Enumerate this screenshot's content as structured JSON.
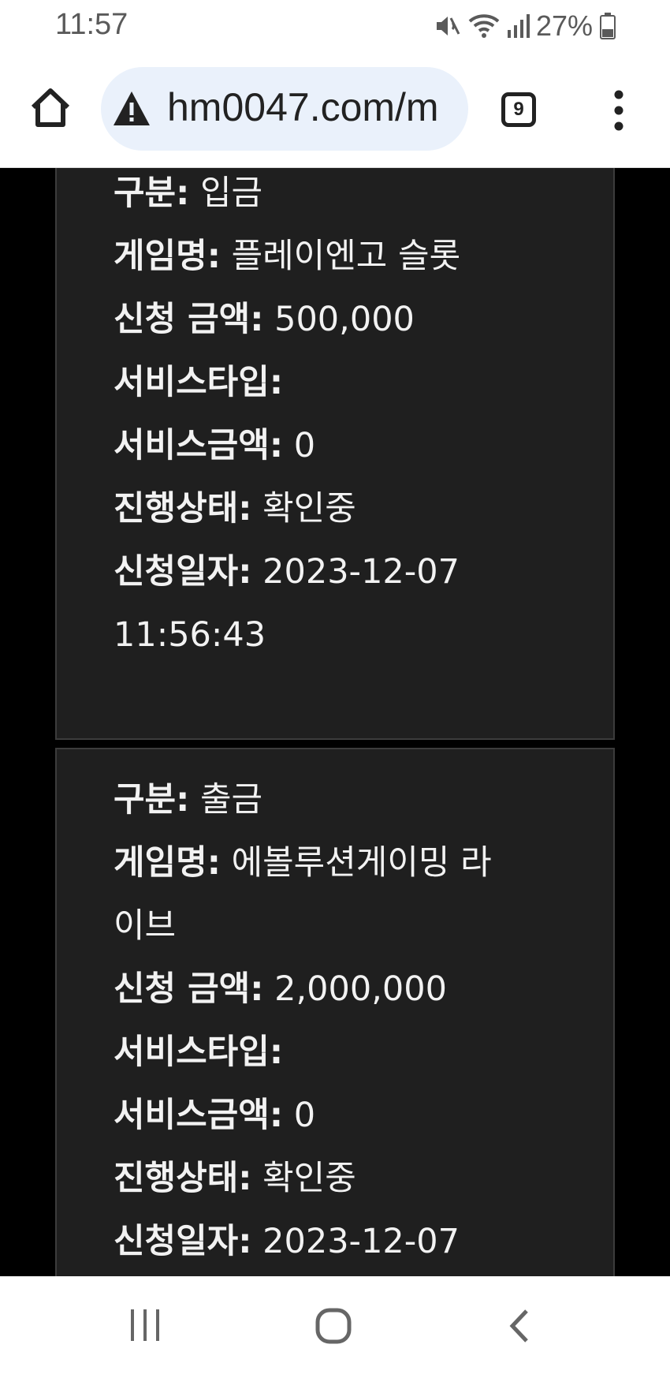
{
  "status_bar": {
    "time": "11:57",
    "battery": "27%",
    "icons": [
      "mute-icon",
      "wifi-icon",
      "signal-icon",
      "battery-icon"
    ]
  },
  "browser": {
    "url": "hm0047.com/m",
    "tab_count": "9",
    "icons": [
      "home-icon",
      "warning-icon",
      "tabs-icon",
      "more-icon"
    ]
  },
  "cards": [
    {
      "rows": [
        {
          "key": "구분",
          "value": "입금"
        },
        {
          "key": "게임명",
          "value": "플레이엔고 슬롯"
        },
        {
          "key": "신청 금액",
          "value": "500,000"
        },
        {
          "key": "서비스타입",
          "value": ""
        },
        {
          "key": "서비스금액",
          "value": "0"
        },
        {
          "key": "진행상태",
          "value": "확인중"
        },
        {
          "key": "신청일자",
          "value": "2023-12-07"
        }
      ],
      "date_time": "11:56:43"
    },
    {
      "rows": [
        {
          "key": "구분",
          "value": "출금"
        },
        {
          "key": "게임명",
          "value": "에볼루션게이밍 라"
        },
        {
          "key": "",
          "value": "이브"
        },
        {
          "key": "신청 금액",
          "value": "2,000,000"
        },
        {
          "key": "서비스타입",
          "value": ""
        },
        {
          "key": "서비스금액",
          "value": "0"
        },
        {
          "key": "진행상태",
          "value": "확인중"
        },
        {
          "key": "신청일자",
          "value": "2023-12-07"
        }
      ]
    }
  ],
  "nav": {
    "icons": [
      "recent-apps-icon",
      "home-circle-icon",
      "back-icon"
    ]
  },
  "colors": {
    "card_bg": "#1f1f1f",
    "card_border": "#3c3c3c",
    "text": "#f2f2f2",
    "url_pill": "#eaf1fb"
  }
}
